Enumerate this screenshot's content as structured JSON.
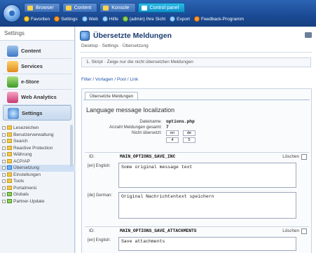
{
  "top_tabs": [
    {
      "label": "Browser"
    },
    {
      "label": "Content"
    },
    {
      "label": "Konsole"
    },
    {
      "label": "Control panel"
    }
  ],
  "toolbar": [
    {
      "label": "Favoriten",
      "icon": "star-icon"
    },
    {
      "label": "Settings",
      "icon": "gear-icon"
    },
    {
      "label": "Web",
      "icon": "globe-icon"
    },
    {
      "label": "Hilfe",
      "icon": "help-icon"
    },
    {
      "label": "(admin) Ihre Sicht",
      "icon": "user-icon"
    },
    {
      "label": "Export",
      "icon": "export-icon"
    },
    {
      "label": "Feedback-Programm",
      "icon": "feedback-icon"
    }
  ],
  "sidebar": {
    "title": "Settings",
    "main_items": [
      {
        "label": "Content"
      },
      {
        "label": "Services"
      },
      {
        "label": "e-Store"
      },
      {
        "label": "Web Analytics"
      },
      {
        "label": "Settings"
      }
    ],
    "tree": [
      {
        "label": "Lesezeichen"
      },
      {
        "label": "Benutzerverwaltung"
      },
      {
        "label": "Search"
      },
      {
        "label": "Reactive Protection"
      },
      {
        "label": "Währung"
      },
      {
        "label": "ACP/AP"
      },
      {
        "label": "Übersetzung"
      },
      {
        "label": "Einstellungen"
      },
      {
        "label": "Tools"
      },
      {
        "label": "Portalmenü"
      },
      {
        "label": "Globals"
      },
      {
        "label": "Partner-Update"
      }
    ]
  },
  "main": {
    "title": "Übersetzte Meldungen",
    "breadcrumb": "Desktop · Settings · Übersetzung",
    "info_bar": "1. Skript · Zeige nur die nicht übersetzten Meldungen",
    "filter_links": "Filter / Vorlagen / Pool / Link",
    "panel_tab": "Übersetzte Meldungen",
    "panel_title": "Language message localization",
    "meta": {
      "file_label": "Dateiname:",
      "file_value": "options.php",
      "count_label": "Anzahl Meldungen gesamt:",
      "count_value": "7",
      "lang_label": "Nicht übersetzt:",
      "lang_cols": [
        "en",
        "de"
      ],
      "lang_vals": [
        "4",
        "5"
      ]
    },
    "entries": [
      {
        "id_label": "ID:",
        "key": "MAIN_OPTIONS_SAVE_INC",
        "delete_label": "Löschen",
        "langs": [
          {
            "label": "[en] English:",
            "value": "Some original message text"
          },
          {
            "label": "[de] German:",
            "value": "Original Nachrichtentext speichern"
          }
        ]
      },
      {
        "id_label": "ID:",
        "key": "MAIN_OPTIONS_SAVE_ATTACHMENTS",
        "delete_label": "Löschen",
        "langs": [
          {
            "label": "[en] English:",
            "value": "Save attachments"
          }
        ]
      }
    ]
  }
}
